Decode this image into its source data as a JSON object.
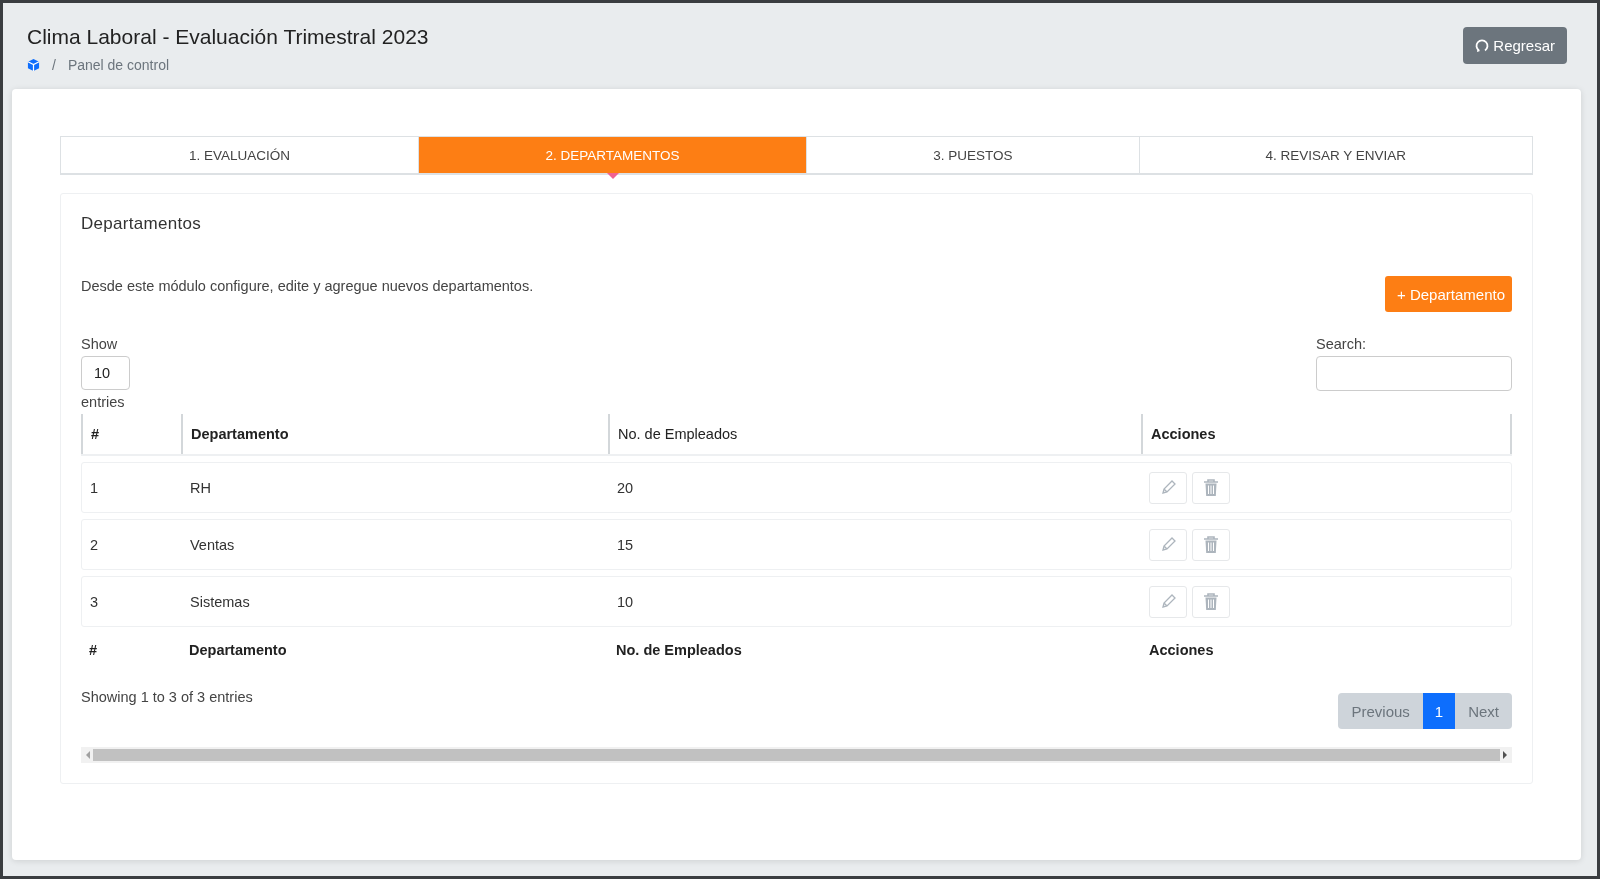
{
  "header": {
    "title": "Clima Laboral - Evaluación Trimestral 2023",
    "breadcrumb": [
      {
        "separator": "/",
        "label": "Panel de control"
      }
    ],
    "back_button": "Regresar"
  },
  "tabs": [
    {
      "label": "1. EVALUACIÓN",
      "selected": false
    },
    {
      "label": "2. DEPARTAMENTOS",
      "selected": true
    },
    {
      "label": "3. PUESTOS",
      "selected": false
    },
    {
      "label": "4. REVISAR Y ENVIAR",
      "selected": false
    }
  ],
  "panel": {
    "title": "Departamentos",
    "description": "Desde este módulo configure, edite y agregue nuevos departamentos.",
    "add_button": "+ Departamento"
  },
  "length": {
    "label_before": "Show",
    "value": "10",
    "label_after": "entries"
  },
  "search": {
    "label": "Search:"
  },
  "table": {
    "columns": [
      {
        "label": "#",
        "bold": true
      },
      {
        "label": "Departamento",
        "bold": true
      },
      {
        "label": "No. de Empleados",
        "bold": false
      },
      {
        "label": "Acciones",
        "bold": true
      }
    ],
    "rows": [
      {
        "number": "1",
        "name": "RH",
        "employees": "20"
      },
      {
        "number": "2",
        "name": "Ventas",
        "employees": "15"
      },
      {
        "number": "3",
        "name": "Sistemas",
        "employees": "10"
      }
    ],
    "footer": [
      "#",
      "Departamento",
      "No. de Empleados",
      "Acciones"
    ]
  },
  "info": "Showing 1 to 3 of 3 entries",
  "pagination": [
    {
      "label": "Previous",
      "kind": "nav",
      "selected": false
    },
    {
      "label": "1",
      "kind": "page",
      "selected": true
    },
    {
      "label": "Next",
      "kind": "nav",
      "selected": false
    }
  ]
}
